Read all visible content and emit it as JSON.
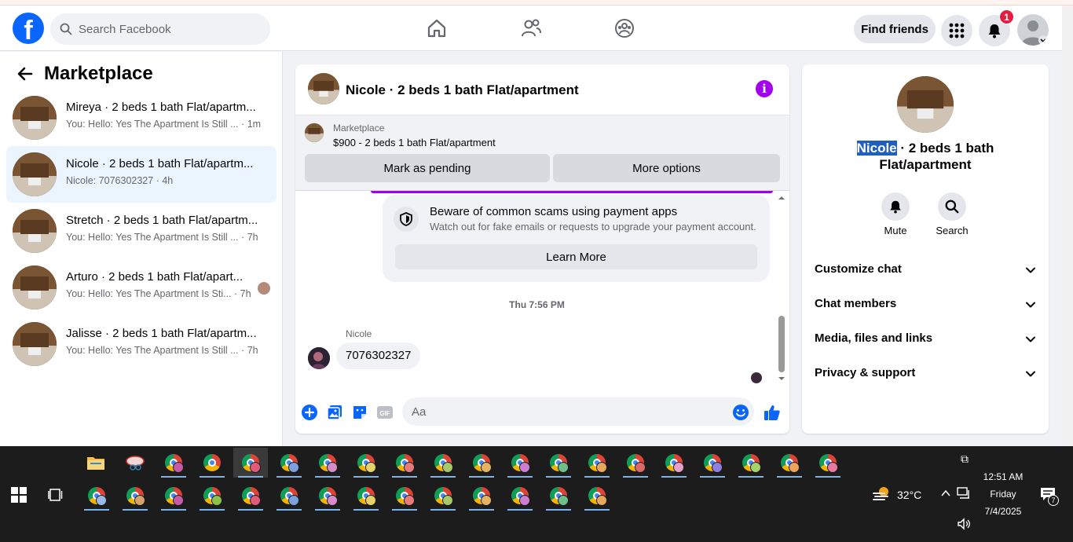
{
  "header": {
    "logo_letter": "f",
    "search_placeholder": "Search Facebook",
    "find_friends": "Find friends",
    "notif_count": "1"
  },
  "sidebar": {
    "title": "Marketplace",
    "conversations": [
      {
        "title": "Mireya · 2 beds 1 bath Flat/apartm...",
        "preview": "You: Hello: Yes The Apartment Is Still ...",
        "time": "· 1m",
        "active": false
      },
      {
        "title": "Nicole · 2 beds 1 bath Flat/apartm...",
        "preview": "Nicole: 7076302327",
        "time": "· 4h",
        "active": true
      },
      {
        "title": "Stretch · 2 beds 1 bath Flat/apartm...",
        "preview": "You: Hello: Yes The Apartment Is Still ...",
        "time": "· 7h",
        "active": false
      },
      {
        "title": "Arturo · 2 beds 1 bath Flat/apart...",
        "preview": "You: Hello: Yes The Apartment Is Sti...",
        "time": "· 7h",
        "active": false
      },
      {
        "title": "Jalisse · 2 beds 1 bath Flat/apartm...",
        "preview": "You: Hello: Yes The Apartment Is Still ...",
        "time": "· 7h",
        "active": false
      }
    ]
  },
  "chat": {
    "title": "Nicole · 2 beds 1 bath Flat/apartment",
    "marketplace_label": "Marketplace",
    "listing": "$900 - 2 beds 1 bath Flat/apartment",
    "mark_pending": "Mark as pending",
    "more_options": "More options",
    "scam_title": "Beware of common scams using payment apps",
    "scam_sub": "Watch out for fake emails or requests to upgrade your payment account.",
    "learn_more": "Learn More",
    "timestamp": "Thu 7:56 PM",
    "sender": "Nicole",
    "message": "7076302327",
    "composer_placeholder": "Aa",
    "gif_label": "GIF"
  },
  "info_panel": {
    "name_highlight": "Nicole",
    "name_rest": " · 2 beds 1 bath Flat/apartment",
    "mute": "Mute",
    "search": "Search",
    "rows": [
      "Customize chat",
      "Chat members",
      "Media, files and links",
      "Privacy & support"
    ]
  },
  "taskbar": {
    "weather": "32°C",
    "time": "12:51 AM",
    "day": "Friday",
    "date": "7/4/2025",
    "notif_count": "7",
    "profile_colors": [
      "#c75aa6",
      "#8bc34a",
      "#e05a7a",
      "#7e9fe0",
      "#d98acb",
      "#e5d36a",
      "#e87a7a",
      "#a8c96a",
      "#e4b45f",
      "#cc7fd1",
      "#6fbf8a",
      "#e6a85a",
      "#d96a6a",
      "#e5a1c8",
      "#8e7fe0",
      "#a3d36a",
      "#f0a35a",
      "#e87aa0",
      "#9ab8e8",
      "#d6a36a"
    ]
  }
}
